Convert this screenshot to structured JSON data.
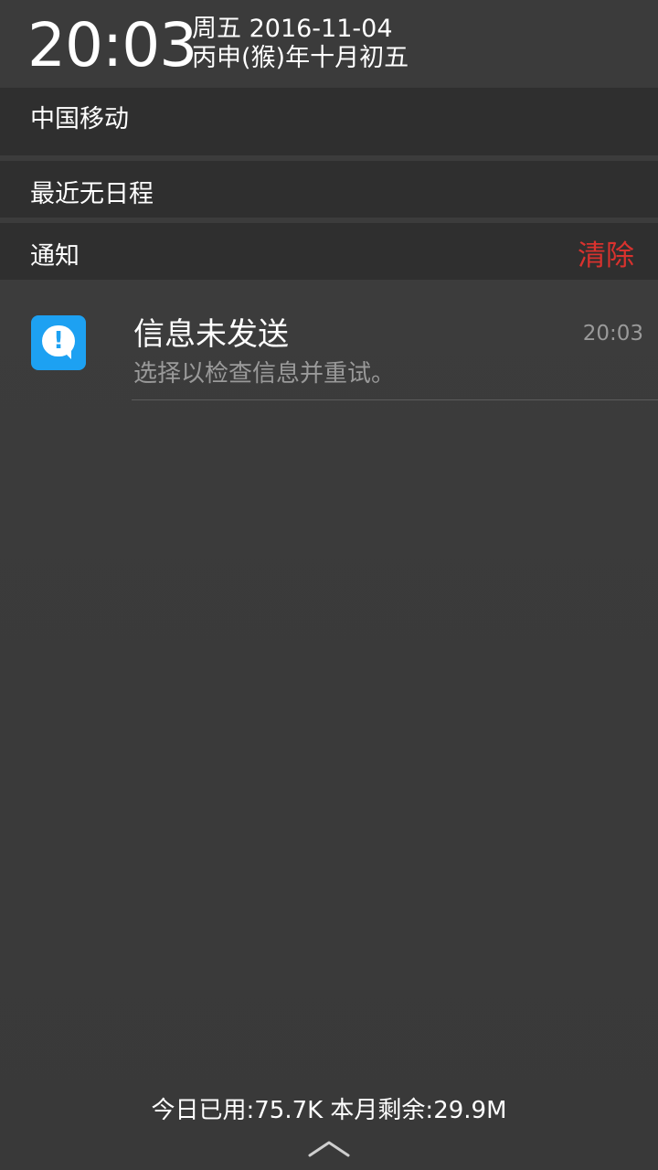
{
  "header": {
    "time": "20:03",
    "date": "周五 2016-11-04",
    "lunar_date": "丙申(猴)年十月初五"
  },
  "carrier": {
    "label": "中国移动"
  },
  "calendar": {
    "label": "最近无日程"
  },
  "notifications": {
    "section_label": "通知",
    "clear_label": "清除",
    "clear_color": "#d9322e",
    "items": [
      {
        "icon": "message-alert-icon",
        "icon_color": "#1da1f2",
        "icon_glyph": "!",
        "title": "信息未发送",
        "body": "选择以检查信息并重试。",
        "time": "20:03"
      }
    ]
  },
  "footer": {
    "data_usage": "今日已用:75.7K 本月剩余:29.9M",
    "handle_icon": "chevron-up-icon"
  }
}
